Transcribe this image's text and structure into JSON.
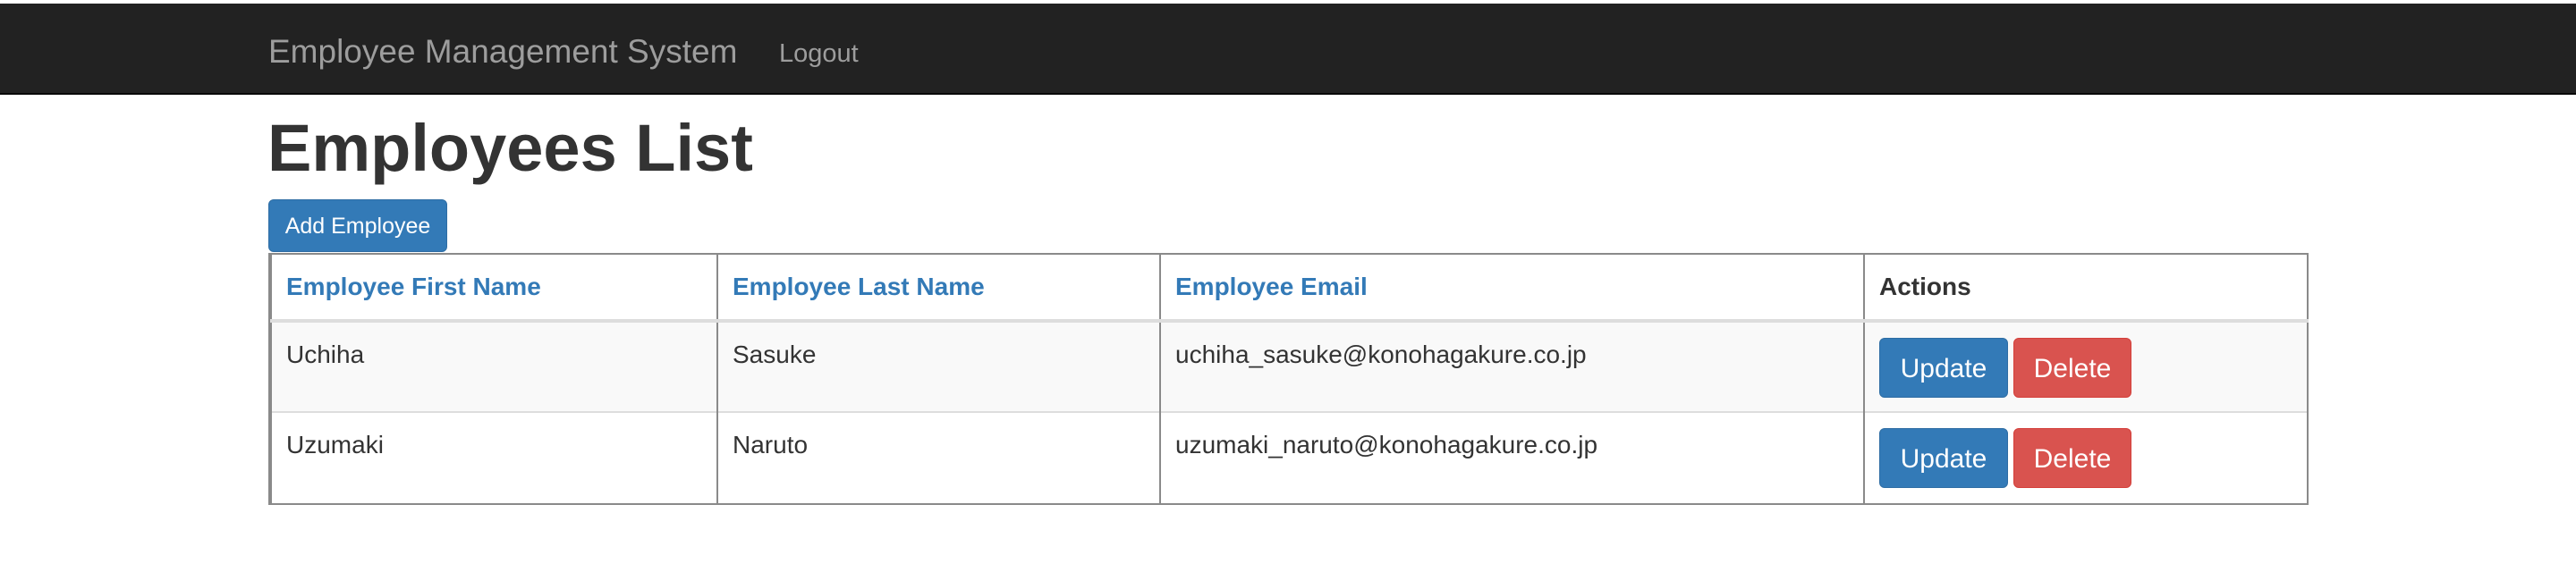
{
  "navbar": {
    "brand": "Employee Management System",
    "logout": "Logout"
  },
  "page": {
    "title": "Employees List",
    "add_button": "Add Employee"
  },
  "table": {
    "headers": [
      "Employee First Name",
      "Employee Last Name",
      "Employee Email",
      "Actions"
    ],
    "rows": [
      {
        "first_name": "Uchiha",
        "last_name": "Sasuke",
        "email": "uchiha_sasuke@konohagakure.co.jp",
        "update": "Update",
        "delete": "Delete"
      },
      {
        "first_name": "Uzumaki",
        "last_name": "Naruto",
        "email": "uzumaki_naruto@konohagakure.co.jp",
        "update": "Update",
        "delete": "Delete"
      }
    ]
  },
  "colors": {
    "navbar_bg": "#222222",
    "primary": "#337ab7",
    "danger": "#d9534f"
  }
}
